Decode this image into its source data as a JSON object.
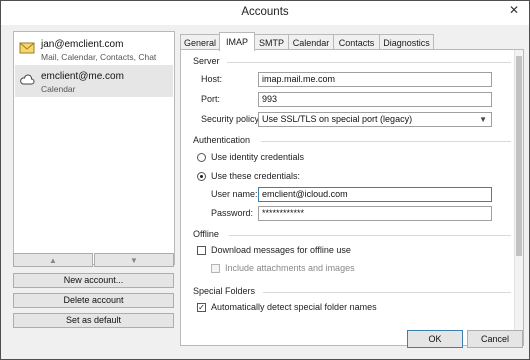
{
  "window": {
    "title": "Accounts",
    "close": "✕"
  },
  "accounts": [
    {
      "name": "jan@emclient.com",
      "services": "Mail, Calendar, Contacts, Chat",
      "icon": "mail-icon"
    },
    {
      "name": "emclient@me.com",
      "services": "Calendar",
      "icon": "cloud-icon"
    }
  ],
  "left_buttons": {
    "up": "▲",
    "down": "▼",
    "new_account": "New account...",
    "delete_account": "Delete account",
    "set_default": "Set as default"
  },
  "tabs": [
    "General",
    "IMAP",
    "SMTP",
    "Calendar",
    "Contacts",
    "Diagnostics"
  ],
  "active_tab": "IMAP",
  "server": {
    "heading": "Server",
    "host_label": "Host:",
    "host_value": "imap.mail.me.com",
    "port_label": "Port:",
    "port_value": "993",
    "security_label": "Security policy:",
    "security_value": "Use SSL/TLS on special port (legacy)"
  },
  "authentication": {
    "heading": "Authentication",
    "identity_option": "Use identity credentials",
    "these_option": "Use these credentials:",
    "selected": "these",
    "username_label": "User name:",
    "username_value": "emclient@icloud.com",
    "password_label": "Password:",
    "password_value": "************"
  },
  "offline": {
    "heading": "Offline",
    "download_label": "Download messages for offline use",
    "download_checked": false,
    "attachments_label": "Include attachments and images",
    "attachments_checked": false
  },
  "special_folders": {
    "heading": "Special Folders",
    "auto_detect_label": "Automatically detect special folder names",
    "auto_detect_checked": true
  },
  "dialog_buttons": {
    "ok": "OK",
    "cancel": "Cancel"
  }
}
